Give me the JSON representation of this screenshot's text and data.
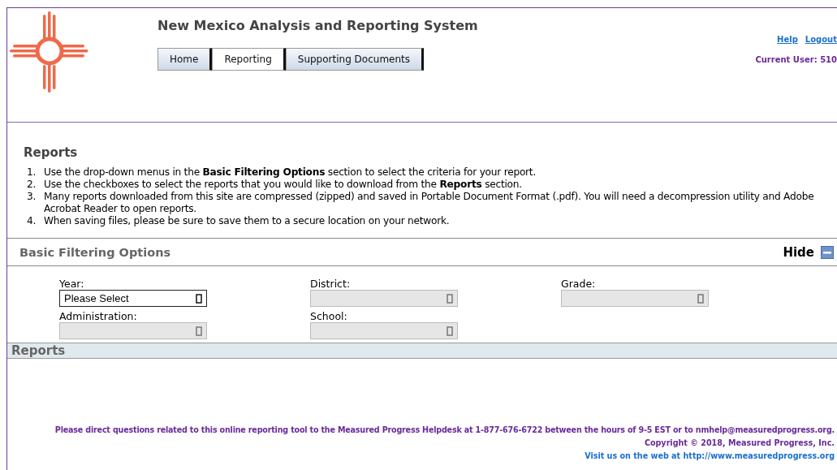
{
  "header": {
    "title": "New Mexico Analysis and Reporting System",
    "tabs": [
      {
        "label": "Home",
        "selected": false
      },
      {
        "label": "Reporting",
        "selected": true
      },
      {
        "label": "Supporting Documents",
        "selected": false
      }
    ],
    "links": [
      "Help",
      "Logout"
    ],
    "current_user": "Current User: 510"
  },
  "intro": {
    "title": "Reports",
    "steps": [
      {
        "marker": "1.",
        "text": "Use the drop-down menus in the **Basic Filtering Options** section to select the criteria for your report."
      },
      {
        "marker": "2.",
        "text": "Use the checkboxes to select the reports that you would like to download from the **Reports** section."
      },
      {
        "marker": "3.",
        "text": "Many reports downloaded from this site are compressed (zipped) and saved in Portable Document Format (.pdf). You will need a decompression utility and Adobe Acrobat Reader to open reports."
      },
      {
        "marker": "4.",
        "text": "When saving files, please be sure to save them to a secure location on your network."
      }
    ]
  },
  "filters": {
    "title": "Basic Filtering Options",
    "toggle": "Hide",
    "fields": [
      {
        "label": "Year:",
        "value": "Please Select",
        "disabled": false
      },
      {
        "label": "District:",
        "disabled": true
      },
      {
        "label": "Grade:",
        "disabled": true
      },
      {
        "label": "Administration:",
        "disabled": true
      },
      {
        "label": "School:",
        "disabled": true
      }
    ]
  },
  "reports": {
    "title": "Reports"
  },
  "footer": {
    "help": "Please direct questions related to this online reporting tool to the Measured Progress Helpdesk at 1-877-676-6722 between the hours of 9-5 EST or to nmhelp@measuredprogress.org.",
    "copyright": "Copyright © 2018, Measured Progress, Inc.",
    "visit": "Visit us on the web at http://www.measuredprogress.org"
  }
}
